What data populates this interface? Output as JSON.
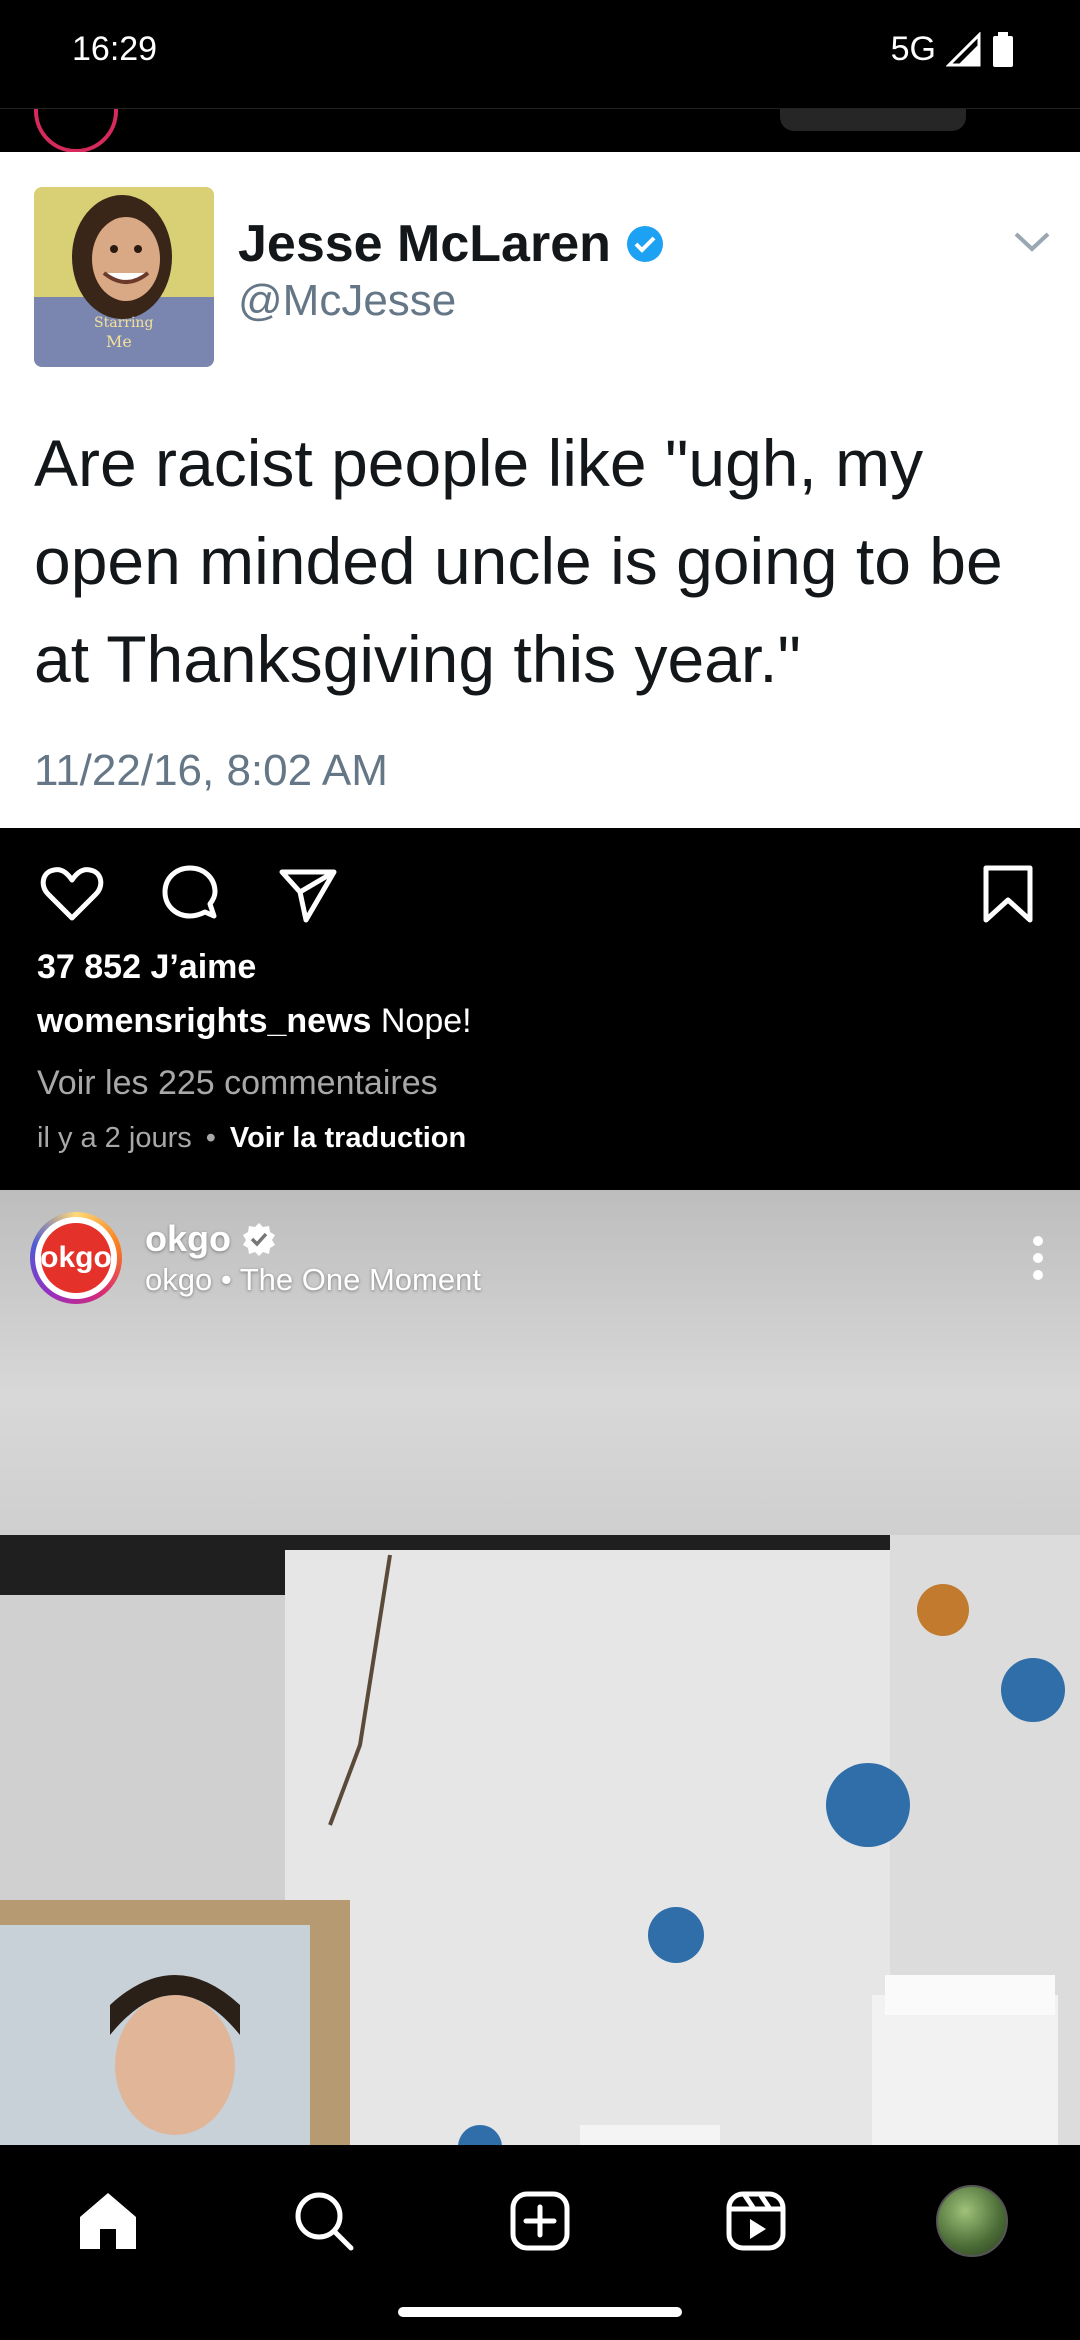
{
  "status_bar": {
    "time": "16:29",
    "network": "5G"
  },
  "tweet": {
    "avatar_caption_line1": "Starring",
    "avatar_caption_line2": "Me",
    "name": "Jesse McLaren",
    "handle": "@McJesse",
    "text": "Are racist people like \"ugh, my open minded uncle is going to be at Thanksgiving this year.\"",
    "date": "11/22/16, 8:02 AM",
    "verified_color": "#1da1f2"
  },
  "post": {
    "likes": "37 852 J’aime",
    "caption_user": "womensrights_news",
    "caption_text": "Nope!",
    "view_comments": "Voir les 225 commentaires",
    "time_ago": "il y a 2 jours",
    "separator": "•",
    "translate": "Voir la traduction"
  },
  "video_post": {
    "username": "okgo",
    "subtitle": "okgo • The One Moment",
    "logo_text": "okgo"
  },
  "icons": {
    "like": "heart-icon",
    "comment": "comment-icon",
    "share": "send-icon",
    "save": "bookmark-icon",
    "more": "more-vertical-icon",
    "home": "home-icon",
    "search": "search-icon",
    "create": "create-icon",
    "reels": "reels-icon",
    "profile": "profile-avatar"
  }
}
